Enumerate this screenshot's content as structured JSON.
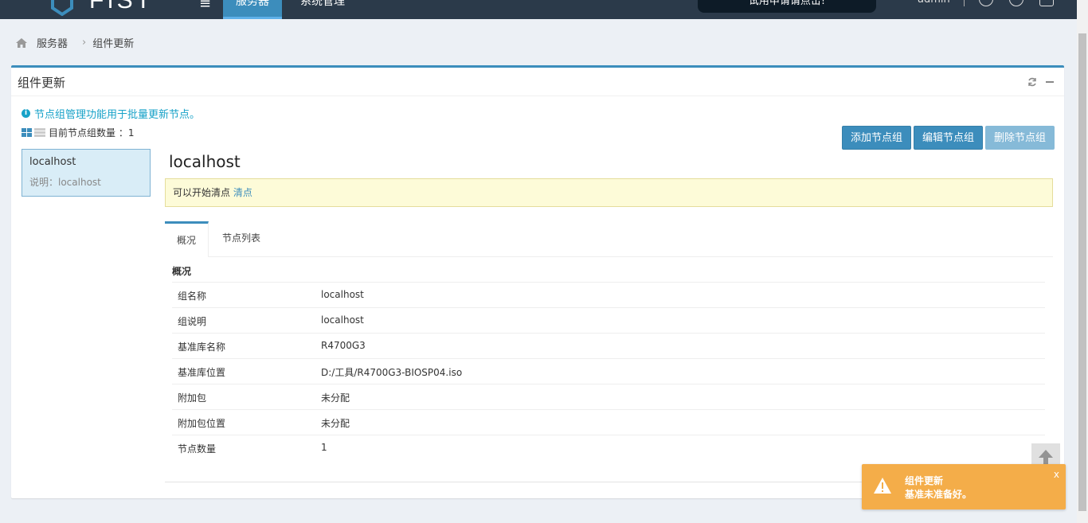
{
  "topbar": {
    "logo_text": "FIST",
    "nav": [
      "服务器",
      "系统管理"
    ],
    "promo": "试用申请请点击!",
    "user": "admin",
    "icons": [
      "menu-icon",
      "settings-icon",
      "help-icon",
      "logout-icon"
    ]
  },
  "breadcrumb": {
    "root": "服务器",
    "current": "组件更新"
  },
  "box": {
    "title": "组件更新",
    "info": "节点组管理功能用于批量更新节点。",
    "count_label": "目前节点组数量 ：1"
  },
  "buttons": {
    "add": "添加节点组",
    "edit": "编辑节点组",
    "delete": "删除节点组"
  },
  "group": {
    "name": "localhost",
    "desc": "说明：localhost"
  },
  "detail": {
    "title": "localhost",
    "alert_text": "可以开始清点",
    "alert_link": "清点",
    "tabs": [
      "概况",
      "节点列表"
    ],
    "section": "概况",
    "rows": [
      {
        "k": "组名称",
        "v": "localhost"
      },
      {
        "k": "组说明",
        "v": "localhost"
      },
      {
        "k": "基准库名称",
        "v": "R4700G3"
      },
      {
        "k": "基准库位置",
        "v": "D:/工具/R4700G3-BIOSP04.iso"
      },
      {
        "k": "附加包",
        "v": "未分配"
      },
      {
        "k": "附加包位置",
        "v": "未分配"
      },
      {
        "k": "节点数量",
        "v": "1"
      }
    ]
  },
  "toast": {
    "title": "组件更新",
    "message": "基准未准备好。",
    "close": "x"
  },
  "colors": {
    "primary": "#3c8dbc",
    "navbar": "#2b3a4a",
    "warning": "#f4ad49",
    "info": "#17a2c8"
  }
}
